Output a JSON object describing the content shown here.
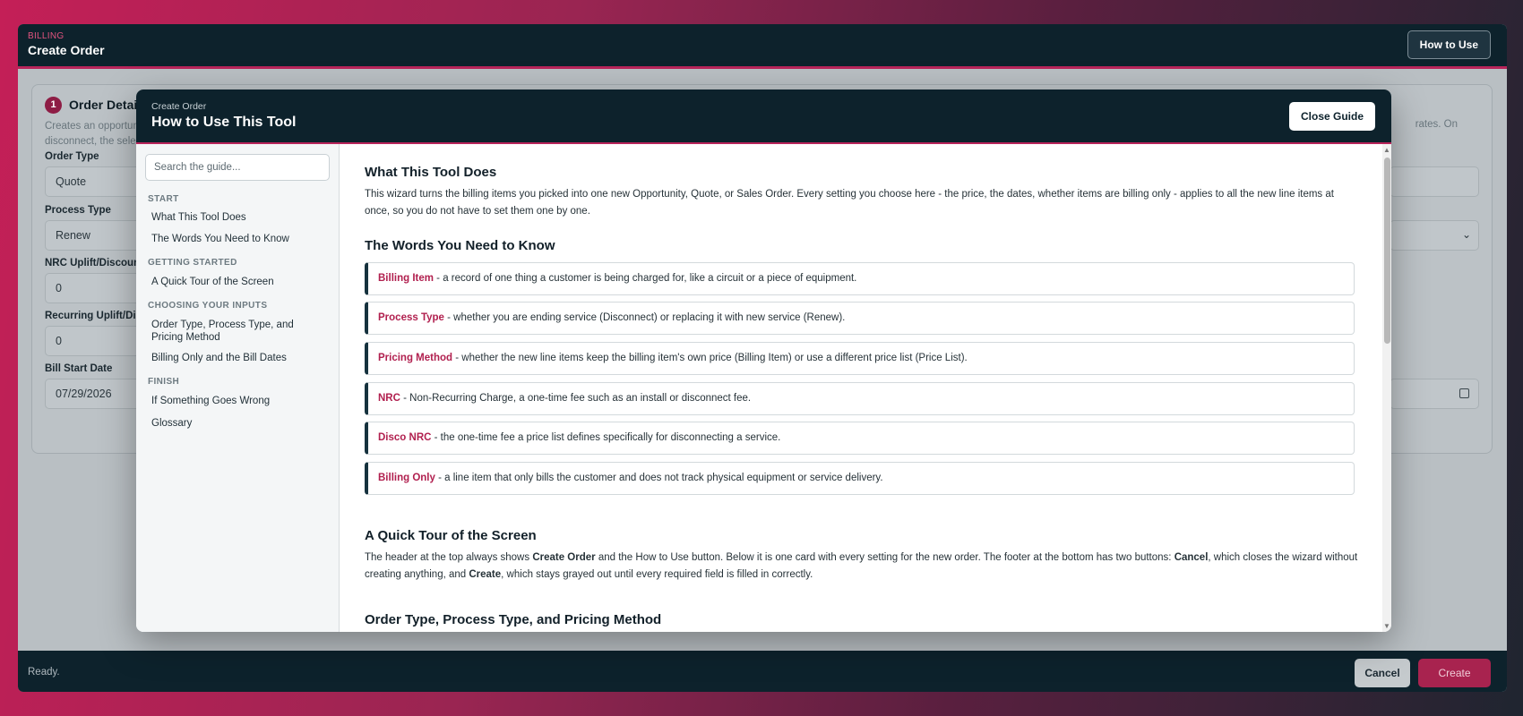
{
  "app": {
    "eyebrow": "BILLING",
    "title": "Create Order",
    "how_to_label": "How to Use"
  },
  "card": {
    "step": "1",
    "title": "Order Detail",
    "desc_line1": "Creates an opportun",
    "desc_line2": "disconnect, the selec",
    "desc_right": "rates. On",
    "fields": [
      {
        "label": "Order Type",
        "value": "Quote"
      },
      {
        "label": "Process Type",
        "value": "Renew"
      },
      {
        "label": "NRC Uplift/Discount",
        "value": "0"
      },
      {
        "label": "Recurring Uplift/Dis",
        "value": "0"
      },
      {
        "label": "Bill Start Date",
        "value": "07/29/2026"
      }
    ]
  },
  "footer": {
    "status": "Ready.",
    "cancel_label": "Cancel",
    "create_label": "Create"
  },
  "modal": {
    "eyebrow": "Create Order",
    "title": "How to Use This Tool",
    "close_label": "Close Guide",
    "search_placeholder": "Search the guide...",
    "nav": [
      {
        "section": "START",
        "items": [
          "What This Tool Does",
          "The Words You Need to Know"
        ]
      },
      {
        "section": "GETTING STARTED",
        "items": [
          "A Quick Tour of the Screen"
        ]
      },
      {
        "section": "CHOOSING YOUR INPUTS",
        "items": [
          "Order Type, Process Type, and Pricing Method",
          "Billing Only and the Bill Dates"
        ]
      },
      {
        "section": "FINISH",
        "items": [
          "If Something Goes Wrong",
          "Glossary"
        ]
      }
    ],
    "content": {
      "s1_title": "What This Tool Does",
      "s1_text": "This wizard turns the billing items you picked into one new Opportunity, Quote, or Sales Order. Every setting you choose here - the price, the dates, whether items are billing only - applies to all the new line items at once, so you do not have to set them one by one.",
      "s2_title": "The Words You Need to Know",
      "terms": [
        {
          "key": "Billing Item",
          "def": " - a record of one thing a customer is being charged for, like a circuit or a piece of equipment."
        },
        {
          "key": "Process Type",
          "def": " - whether you are ending service (Disconnect) or replacing it with new service (Renew)."
        },
        {
          "key": "Pricing Method",
          "def": " - whether the new line items keep the billing item's own price (Billing Item) or use a different price list (Price List)."
        },
        {
          "key": "NRC",
          "def": " - Non-Recurring Charge, a one-time fee such as an install or disconnect fee."
        },
        {
          "key": "Disco NRC",
          "def": " - the one-time fee a price list defines specifically for disconnecting a service."
        },
        {
          "key": "Billing Only",
          "def": " - a line item that only bills the customer and does not track physical equipment or service delivery."
        }
      ],
      "s3_title": "A Quick Tour of the Screen",
      "s3_a": "The header at the top always shows ",
      "s3_b": "Create Order",
      "s3_c": " and the How to Use button. Below it is one card with every setting for the new order. The footer at the bottom has two buttons: ",
      "s3_d": "Cancel",
      "s3_e": ", which closes the wizard without creating anything, and ",
      "s3_f": "Create",
      "s3_g": ", which stays grayed out until every required field is filled in correctly.",
      "s4_title": "Order Type, Process Type, and Pricing Method"
    }
  }
}
